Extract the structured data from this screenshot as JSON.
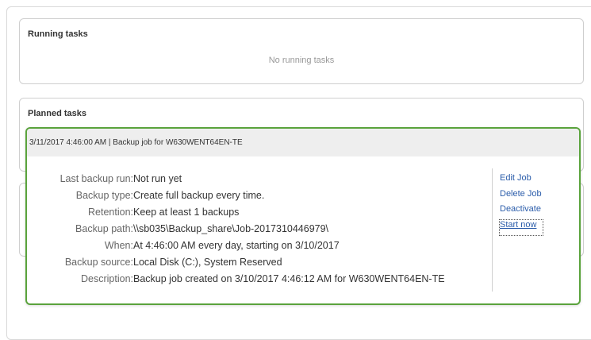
{
  "running_tasks": {
    "title": "Running tasks",
    "empty_message": "No running tasks"
  },
  "planned_tasks": {
    "title": "Planned tasks"
  },
  "task": {
    "header": "3/11/2017 4:46:00 AM | Backup job for W630WENT64EN-TE",
    "details": [
      {
        "label": "Last backup run:",
        "value": "Not run yet"
      },
      {
        "label": "Backup type:",
        "value": "Create full backup every time."
      },
      {
        "label": "Retention:",
        "value": "Keep at least 1 backups"
      },
      {
        "label": "Backup path:",
        "value": "\\\\sb035\\Backup_share\\Job-2017310446979\\"
      },
      {
        "label": "When:",
        "value": "At 4:46:00 AM every day, starting on 3/10/2017"
      },
      {
        "label": "Backup source:",
        "value": "Local Disk (C:), System Reserved"
      },
      {
        "label": "Description:",
        "value": "Backup job created on 3/10/2017 4:46:12 AM for W630WENT64EN-TE"
      }
    ],
    "actions": {
      "edit": "Edit Job",
      "delete": "Delete Job",
      "deactivate": "Deactivate",
      "start": "Start now"
    }
  },
  "colors": {
    "accent_border": "#5aa33c",
    "link": "#2a5caa"
  }
}
